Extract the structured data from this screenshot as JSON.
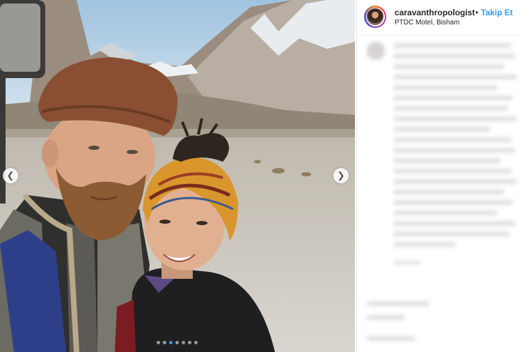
{
  "post": {
    "username": "caravanthropologist",
    "separator": "•",
    "follow_label": "Takip Et",
    "location": "PTDC Motel, Bisham"
  },
  "carousel": {
    "slides_total": 7,
    "active_index": 2,
    "prev_icon": "chevron-left-icon",
    "next_icon": "chevron-right-icon"
  },
  "colors": {
    "link_blue": "#3897f0",
    "text": "#262626"
  }
}
